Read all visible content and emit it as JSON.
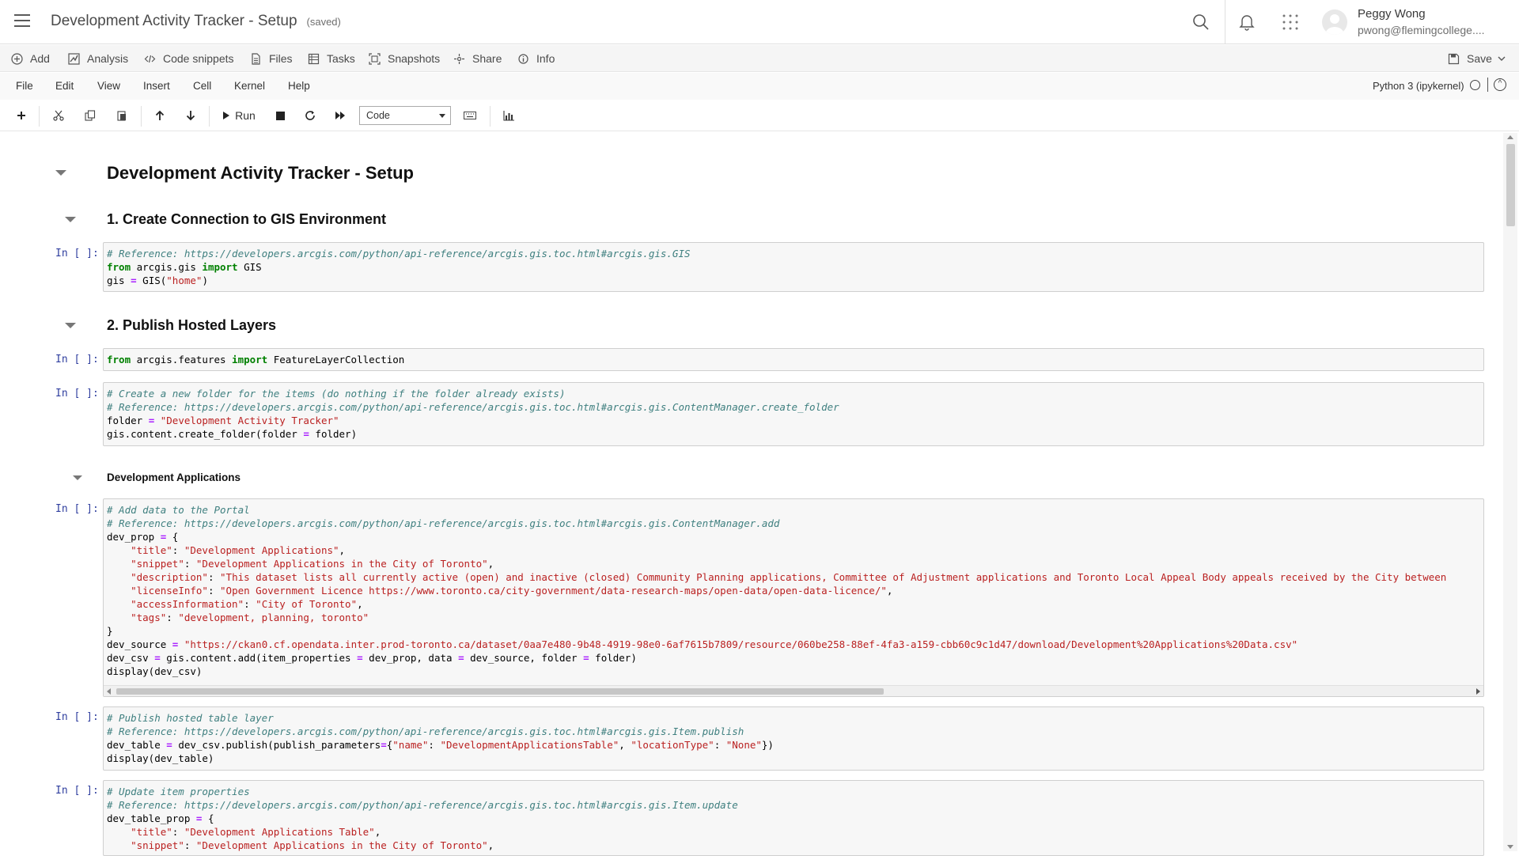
{
  "header": {
    "title": "Development Activity Tracker - Setup",
    "saved": "(saved)",
    "user_name": "Peggy Wong",
    "user_email": "pwong@flemingcollege...."
  },
  "arcgis_toolbar": [
    {
      "label": "Add",
      "icon": "plus-circle-icon"
    },
    {
      "label": "Analysis",
      "icon": "analysis-icon"
    },
    {
      "label": "Code snippets",
      "icon": "code-icon"
    },
    {
      "label": "Files",
      "icon": "file-icon"
    },
    {
      "label": "Tasks",
      "icon": "tasks-icon"
    },
    {
      "label": "Snapshots",
      "icon": "snapshot-icon"
    },
    {
      "label": "Share",
      "icon": "share-icon"
    },
    {
      "label": "Info",
      "icon": "info-icon"
    },
    {
      "label": "Save",
      "icon": "save-icon"
    }
  ],
  "menus": [
    "File",
    "Edit",
    "View",
    "Insert",
    "Cell",
    "Kernel",
    "Help"
  ],
  "kernel": "Python 3 (ipykernel)",
  "toolbar": {
    "run_label": "Run",
    "cell_type": "Code"
  },
  "notebook": {
    "title": "Development Activity Tracker - Setup",
    "section1": "1. Create Connection to GIS Environment",
    "section2": "2. Publish Hosted Layers",
    "subsection": "Development Applications",
    "prompt": "In [ ]:"
  },
  "colors": {
    "prompt": "#303f9f",
    "comment": "#408080",
    "keyword": "#008000",
    "string": "#ba2121"
  }
}
